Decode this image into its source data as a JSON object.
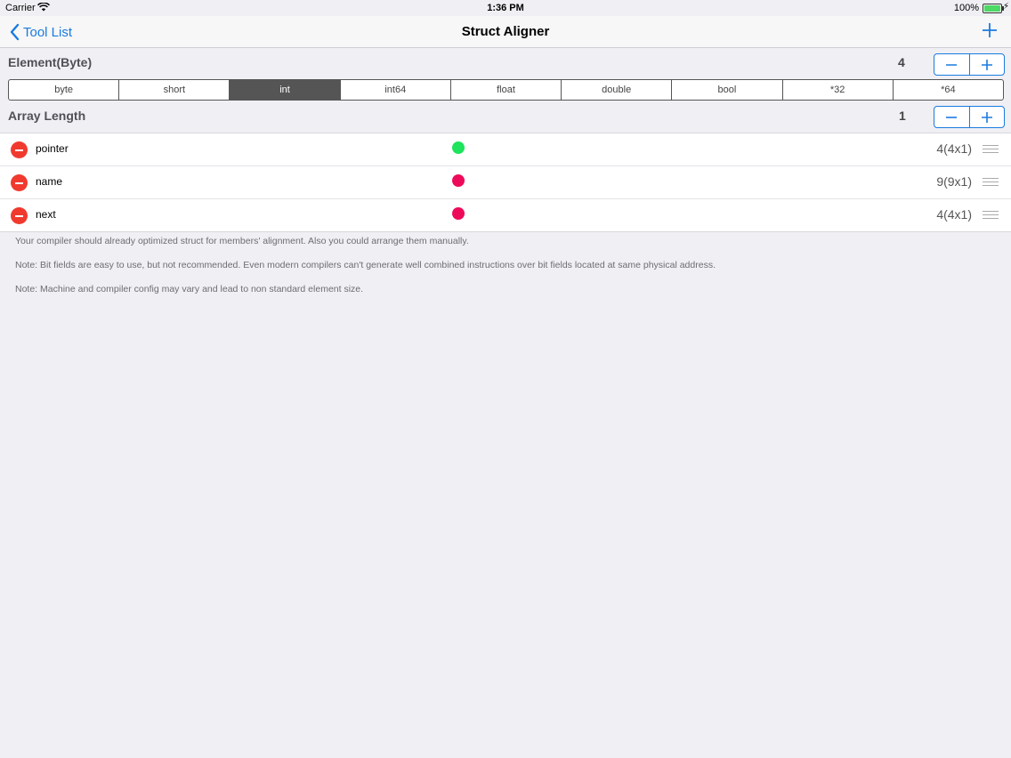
{
  "status": {
    "carrier": "Carrier",
    "time": "1:36 PM",
    "battery": "100%",
    "battery_level": 100
  },
  "nav": {
    "back_label": "Tool List",
    "title": "Struct Aligner",
    "add_icon": "plus-icon"
  },
  "element": {
    "label": "Element(Byte)",
    "value": "4"
  },
  "types": {
    "options": [
      "byte",
      "short",
      "int",
      "int64",
      "float",
      "double",
      "bool",
      "*32",
      "*64"
    ],
    "selected": "int"
  },
  "array": {
    "label": "Array Length",
    "value": "1"
  },
  "members": [
    {
      "name": "pointer",
      "status_color": "#1ee35c",
      "size": "4(4x1)"
    },
    {
      "name": "name",
      "status_color": "#ee0a5a",
      "size": "9(9x1)"
    },
    {
      "name": "next",
      "status_color": "#ee0a5a",
      "size": "4(4x1)"
    }
  ],
  "notes": [
    "Your compiler should already optimized struct  for members' alignment. Also you could arrange them manually.",
    "Note: Bit fields are easy to use, but not recommended. Even modern compilers can't generate well combined instructions over bit fields located at same physical address.",
    "Note: Machine and compiler config may vary and lead to non standard element size."
  ],
  "colors": {
    "accent": "#1a7be0",
    "delete": "#f03a2e",
    "segment_selected": "#555555"
  }
}
